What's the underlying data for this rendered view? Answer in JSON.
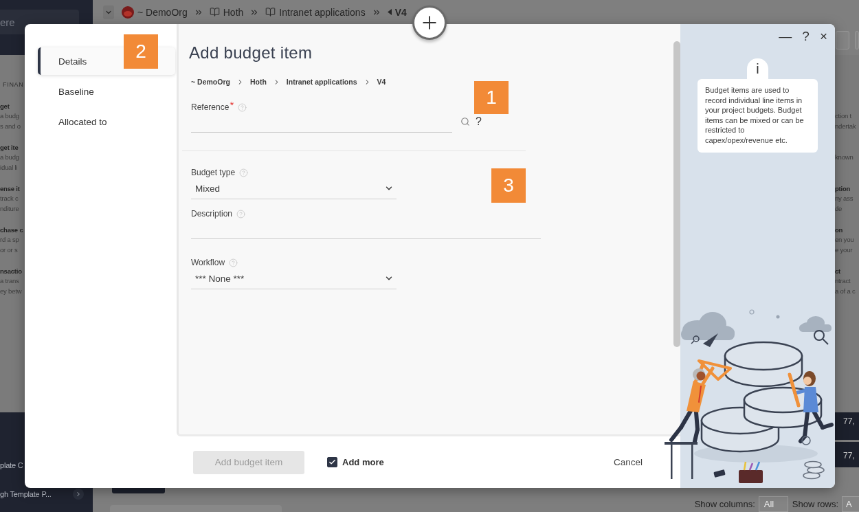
{
  "background": {
    "search": {
      "placeholder": "ere"
    },
    "breadcrumb": [
      {
        "kind": "org",
        "label": "~ DemoOrg"
      },
      {
        "kind": "book",
        "label": "Hoth"
      },
      {
        "kind": "book",
        "label": "Intranet applications"
      },
      {
        "kind": "current",
        "label": "V4"
      }
    ],
    "menu": {
      "heading": "FINAN",
      "left_items": [
        {
          "title": "get",
          "lines": [
            "a budg",
            "s and o"
          ]
        },
        {
          "title": "get ite",
          "lines": [
            "a budg",
            "idual li"
          ]
        },
        {
          "title": "ense it",
          "lines": [
            "track c",
            "nditure"
          ]
        },
        {
          "title": "chase c",
          "lines": [
            "rd a sp",
            "or or s"
          ]
        },
        {
          "title": "nsactio",
          "lines": [
            "a trans",
            "ey betw"
          ]
        }
      ],
      "right_items": [
        {
          "lines": [
            "ction t",
            "ndertak"
          ]
        },
        {
          "lines": [
            "known"
          ]
        },
        {
          "title": "ption",
          "lines": [
            "ny ass",
            "de"
          ]
        },
        {
          "title": "on",
          "lines": [
            "en you",
            "e your"
          ]
        },
        {
          "title": "ct",
          "lines": [
            "ntract",
            "a of a c"
          ]
        }
      ]
    },
    "sidebar_items": [
      "plate C",
      "gh Template P..."
    ],
    "table_cells": [
      "77,",
      "77,"
    ],
    "show_columns": {
      "label": "Show columns:",
      "value": "All"
    },
    "show_rows": {
      "label": "Show rows:",
      "value": "A"
    }
  },
  "modal": {
    "window_controls": [
      "—",
      "?",
      "×"
    ],
    "nav": [
      {
        "label": "Details",
        "selected": true
      },
      {
        "label": "Baseline",
        "selected": false
      },
      {
        "label": "Allocated to",
        "selected": false
      }
    ],
    "nav_callout": "2",
    "title": "Add budget item",
    "breadcrumb": [
      "~ DemoOrg",
      "Hoth",
      "Intranet applications",
      "V4"
    ],
    "sections": [
      {
        "callout": "1",
        "fields": [
          {
            "kind": "lookup",
            "label": "Reference",
            "required_mark": "*",
            "help_mark": "?"
          }
        ]
      },
      {
        "callout": "3",
        "fields": [
          {
            "kind": "select",
            "label": "Budget type",
            "value": "Mixed"
          },
          {
            "kind": "text",
            "label": "Description"
          },
          {
            "kind": "select",
            "label": "Workflow",
            "value": "*** None ***"
          }
        ]
      }
    ],
    "info": {
      "badge": "i",
      "text": "Budget items are used to record individual line items in your project budgets. Budget items can be mixed or can be restricted to capex/opex/revenue etc."
    },
    "footer": {
      "submit": {
        "label": "Add budget item",
        "disabled": true
      },
      "add_more": {
        "label": "Add more",
        "checked": true
      },
      "cancel": "Cancel"
    }
  }
}
